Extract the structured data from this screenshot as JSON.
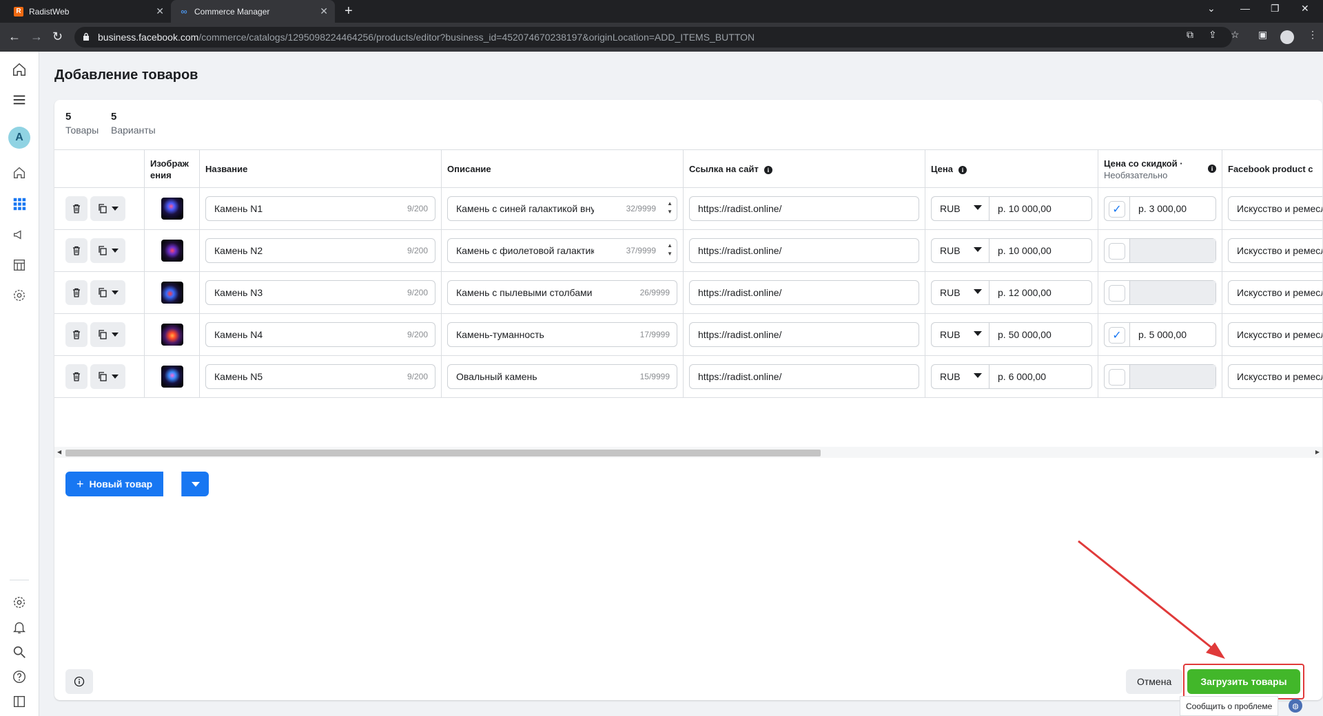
{
  "browser": {
    "tabs": [
      {
        "title": "RadistWeb",
        "icon": "R"
      },
      {
        "title": "Commerce Manager",
        "icon": "∞"
      }
    ],
    "url_host": "business.facebook.com",
    "url_path": "/commerce/catalogs/1295098224464256/products/editor?business_id=452074670238197&originLocation=ADD_ITEMS_BUTTON"
  },
  "sidebar": {
    "avatar_letter": "A"
  },
  "page": {
    "title": "Добавление товаров",
    "stats": [
      {
        "number": "5",
        "label": "Товары"
      },
      {
        "number": "5",
        "label": "Варианты"
      }
    ]
  },
  "table": {
    "headers": {
      "image": "Изображ ения",
      "name": "Название",
      "description": "Описание",
      "link": "Ссылка на сайт",
      "price": "Цена",
      "sale_price": "Цена со скидкой ·",
      "sale_price_sub": "Необязательно",
      "fb_category": "Facebook product c"
    },
    "rows": [
      {
        "name": "Камень N1",
        "name_count": "9/200",
        "desc": "Камень с синей галактикой внутри",
        "desc_count": "32/9999",
        "link": "https://radist.online/",
        "currency": "RUB",
        "price": "р. 10 000,00",
        "sale_checked": true,
        "sale_price": "р. 3 000,00",
        "category": "Искусство и ремесла"
      },
      {
        "name": "Камень N2",
        "name_count": "9/200",
        "desc": "Камень с фиолетовой галактикой внутри",
        "desc_count": "37/9999",
        "link": "https://radist.online/",
        "currency": "RUB",
        "price": "р. 10 000,00",
        "sale_checked": false,
        "sale_price": "",
        "category": "Искусство и ремесла"
      },
      {
        "name": "Камень N3",
        "name_count": "9/200",
        "desc": "Камень с пылевыми столбами",
        "desc_count": "26/9999",
        "link": "https://radist.online/",
        "currency": "RUB",
        "price": "р. 12 000,00",
        "sale_checked": false,
        "sale_price": "",
        "category": "Искусство и ремесла"
      },
      {
        "name": "Камень N4",
        "name_count": "9/200",
        "desc": "Камень-туманность",
        "desc_count": "17/9999",
        "link": "https://radist.online/",
        "currency": "RUB",
        "price": "р. 50 000,00",
        "sale_checked": true,
        "sale_price": "р. 5 000,00",
        "category": "Искусство и ремесла"
      },
      {
        "name": "Камень N5",
        "name_count": "9/200",
        "desc": "Овальный камень",
        "desc_count": "15/9999",
        "link": "https://radist.online/",
        "currency": "RUB",
        "price": "р. 6 000,00",
        "sale_checked": false,
        "sale_price": "",
        "category": "Искусство и ремесла"
      }
    ]
  },
  "actions": {
    "new_item": "Новый товар",
    "cancel": "Отмена",
    "upload": "Загрузить товары",
    "report": "Сообщить о проблеме"
  },
  "colors": {
    "primary": "#1877f2",
    "upload": "#42b72a",
    "annotation": "#e03a3a"
  }
}
